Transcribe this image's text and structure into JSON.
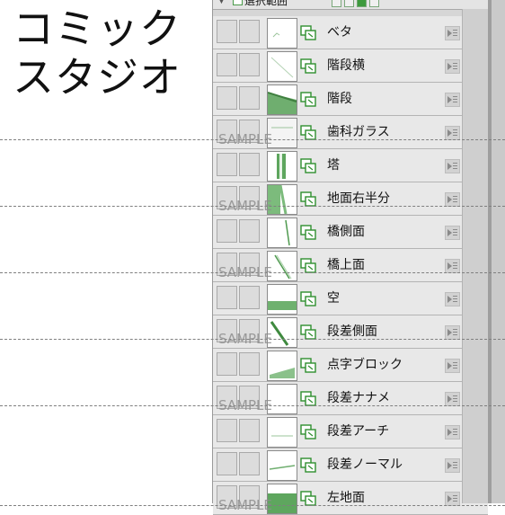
{
  "title": {
    "line1": "コミック",
    "line2": "スタジオ"
  },
  "panel": {
    "header_label": "選択範囲",
    "colors": {
      "panel": "#d6d6d6",
      "row": "#e8e8e8",
      "accent": "#3d9a3d"
    }
  },
  "layers": [
    {
      "name": "ベタ",
      "thumb": "beta"
    },
    {
      "name": "階段横",
      "thumb": "stairs-side"
    },
    {
      "name": "階段",
      "thumb": "stairs"
    },
    {
      "name": "歯科ガラス",
      "thumb": "glass"
    },
    {
      "name": "塔",
      "thumb": "tower"
    },
    {
      "name": "地面右半分",
      "thumb": "ground-right"
    },
    {
      "name": "橋側面",
      "thumb": "bridge-side"
    },
    {
      "name": "橋上面",
      "thumb": "bridge-top"
    },
    {
      "name": "空",
      "thumb": "sky"
    },
    {
      "name": "段差側面",
      "thumb": "step-side"
    },
    {
      "name": "点字ブロック",
      "thumb": "braille"
    },
    {
      "name": "段差ナナメ",
      "thumb": "step-diagonal"
    },
    {
      "name": "段差アーチ",
      "thumb": "step-arch"
    },
    {
      "name": "段差ノーマル",
      "thumb": "step-normal"
    },
    {
      "name": "左地面",
      "thumb": "ground-left"
    }
  ],
  "icons": {
    "type_icon": "layer-type-icon",
    "menu_icon": "layer-menu-icon",
    "visibility": "checkbox"
  },
  "watermark": {
    "text": "SAMPLE"
  }
}
